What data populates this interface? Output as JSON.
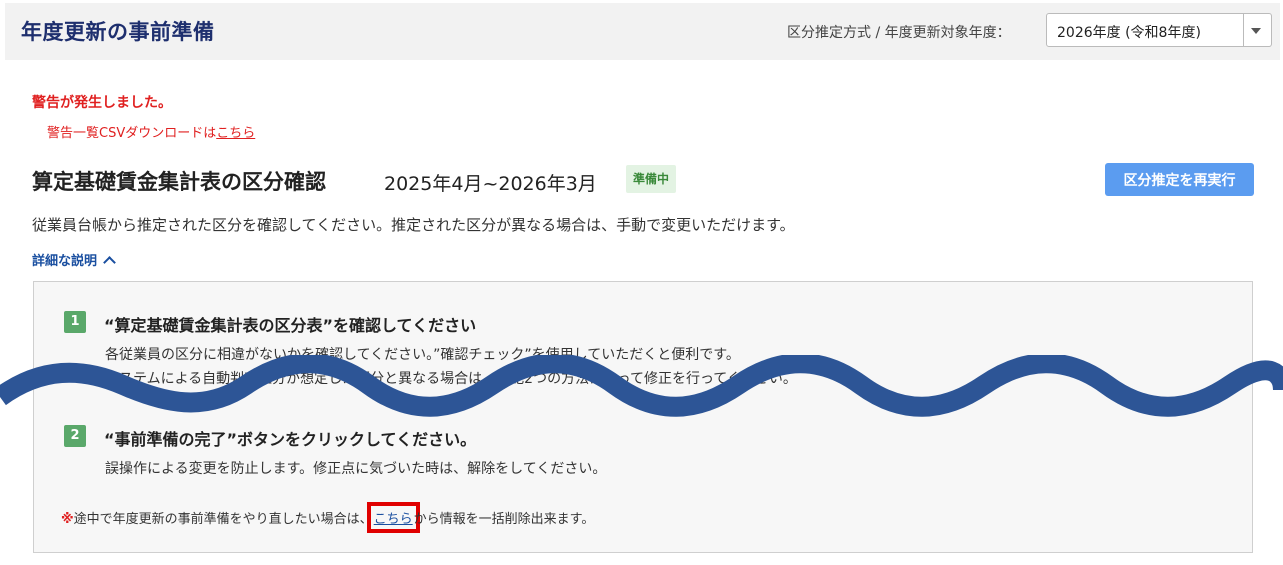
{
  "header": {
    "title": "年度更新の事前準備",
    "year_label": "区分推定方式 / 年度更新対象年度：",
    "year_value": "2026年度 (令和8年度)"
  },
  "warning": {
    "title": "警告が発生しました。",
    "csv_text": "警告一覧CSVダウンロードは",
    "csv_link": "こちら"
  },
  "section": {
    "title": "算定基礎賃金集計表の区分確認",
    "period": "2025年4月~2026年3月",
    "status": "準備中",
    "rerun_label": "区分推定を再実行",
    "description": "従業員台帳から推定された区分を確認してください。推定された区分が異なる場合は、手動で変更いただけます。",
    "detail_toggle": "詳細な説明"
  },
  "steps": [
    {
      "num": "1",
      "title": "“算定基礎賃金集計表の区分表”を確認してください",
      "body1": "各従業員の区分に相違がないかを確認してください。”確認チェック”を使用していただくと便利です。",
      "body2": "システムによる自動判定区分が想定した区分と異なる場合は、下記2つの方法によって修正を行ってください。"
    },
    {
      "num": "2",
      "title": "“事前準備の完了”ボタンをクリックしてください。",
      "body1": "誤操作による変更を防止します。修正点に気づいた時は、解除をしてください。"
    }
  ],
  "note": {
    "mark": "※",
    "prefix": "途中で年度更新の事前準備をやり直したい場合は、",
    "link": "こちら",
    "suffix": "から情報を一括削除出来ます。"
  },
  "colors": {
    "title_navy": "#1e2f6e",
    "warning_red": "#e02020",
    "button_blue": "#5b9cf0",
    "step_green": "#5aa86a",
    "wave_blue": "#2d5596",
    "highlight_red": "#e00000"
  }
}
